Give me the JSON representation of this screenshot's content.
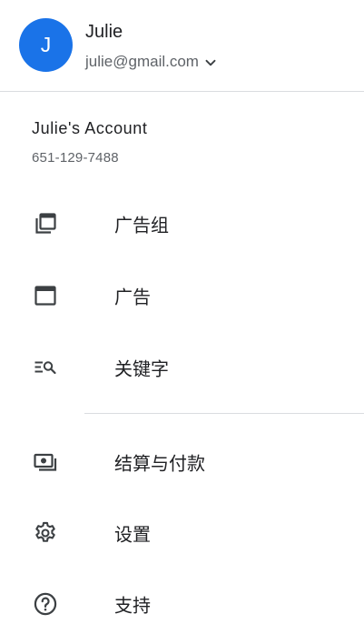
{
  "user": {
    "initial": "J",
    "name": "Julie",
    "email": "julie@gmail.com",
    "avatar_color": "#1a73e8"
  },
  "account": {
    "name": "Julie's Account",
    "phone": "651-129-7488"
  },
  "menu": {
    "items": [
      {
        "label": "广告组",
        "icon": "ad-groups-icon"
      },
      {
        "label": "广告",
        "icon": "ads-icon"
      },
      {
        "label": "关键字",
        "icon": "keywords-icon"
      },
      {
        "label": "结算与付款",
        "icon": "billing-icon"
      },
      {
        "label": "设置",
        "icon": "settings-icon"
      },
      {
        "label": "支持",
        "icon": "help-icon"
      }
    ]
  },
  "colors": {
    "text_primary": "#202124",
    "text_secondary": "#5f6368",
    "divider": "#dadce0",
    "icon": "#3c4043"
  }
}
